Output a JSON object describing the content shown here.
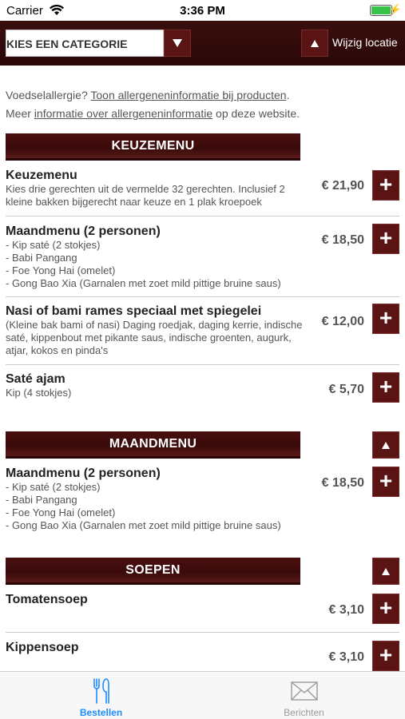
{
  "status": {
    "carrier": "Carrier",
    "time": "3:36 PM"
  },
  "header": {
    "category_label": "KIES EEN CATEGORIE",
    "location_label": "Wijzig locatie"
  },
  "allergy": {
    "line1_text": "Voedselallergie?",
    "line1_link": "Toon allergeneninformatie bij producten",
    "line1_end": ".",
    "line2_text": "Meer",
    "line2_link": "informatie over allergeneninformatie",
    "line2_end": "op deze website."
  },
  "sections": {
    "keuzemenu": {
      "title": "KEUZEMENU"
    },
    "maandmenu": {
      "title": "MAANDMENU"
    },
    "soepen": {
      "title": "SOEPEN"
    }
  },
  "items": {
    "keuzemenu": {
      "name": "Keuzemenu",
      "desc": "Kies drie gerechten uit de vermelde 32 gerechten. Inclusief 2 kleine bakken bijgerecht naar keuze en 1 plak kroepoek",
      "price": "€ 21,90"
    },
    "maandmenu1": {
      "name": "Maandmenu (2 personen)",
      "desc1": "- Kip saté (2 stokjes)",
      "desc2": "- Babi Pangang",
      "desc3": "- Foe Yong Hai (omelet)",
      "desc4": "- Gong Bao Xia (Garnalen met zoet mild pittige bruine saus)",
      "price": "€ 18,50"
    },
    "nasi": {
      "name": "Nasi of bami rames speciaal met spiegelei",
      "desc": "(Kleine bak bami of nasi) Daging roedjak, daging kerrie, indische saté, kippenbout met pikante saus, indische groenten, augurk, atjar, kokos en pinda's",
      "price": "€ 12,00"
    },
    "sate": {
      "name": "Saté ajam",
      "desc": "Kip (4 stokjes)",
      "price": "€ 5,70"
    },
    "maandmenu2": {
      "name": "Maandmenu (2 personen)",
      "desc1": "- Kip saté (2 stokjes)",
      "desc2": "- Babi Pangang",
      "desc3": "- Foe Yong Hai (omelet)",
      "desc4": "- Gong Bao Xia (Garnalen met zoet mild pittige bruine saus)",
      "price": "€ 18,50"
    },
    "tomatensoep": {
      "name": "Tomatensoep",
      "price": "€ 3,10"
    },
    "kippensoep": {
      "name": "Kippensoep",
      "price": "€ 3,10"
    }
  },
  "add_symbol": "+",
  "tabs": {
    "order": {
      "label": "Bestellen",
      "icon": "fork-knife-icon",
      "color": "#1a8cff"
    },
    "messages": {
      "label": "Berichten",
      "icon": "envelope-icon",
      "color": "#9a9a9a"
    }
  },
  "colors": {
    "brand": "#5a1414",
    "header_bg": "#2a0808",
    "tab_active": "#1a8cff",
    "battery": "#37c24a"
  }
}
